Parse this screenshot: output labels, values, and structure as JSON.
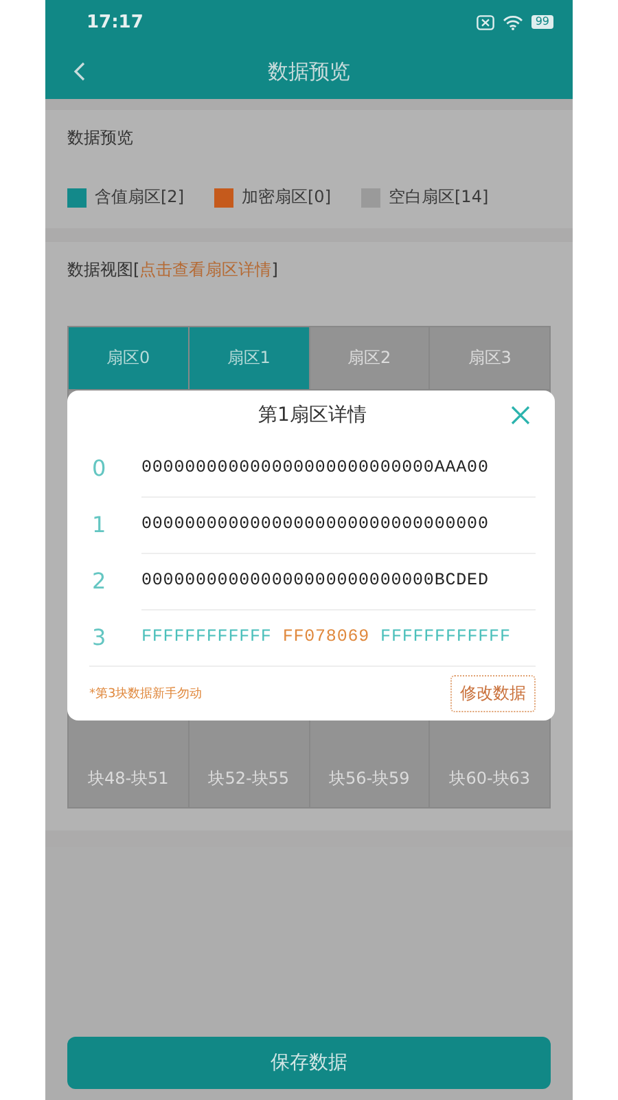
{
  "status_bar": {
    "time": "17:17",
    "battery": "99"
  },
  "header": {
    "title": "数据预览"
  },
  "preview": {
    "title": "数据预览",
    "legend": [
      {
        "label": "含值扇区[2]",
        "color": "#13898a"
      },
      {
        "label": "加密扇区[0]",
        "color": "#c55a1c"
      },
      {
        "label": "空白扇区[14]",
        "color": "#9a9a9a"
      }
    ]
  },
  "view": {
    "title_start": "数据视图[",
    "link": "点击查看扇区详情",
    "title_end": "]"
  },
  "sectors": [
    {
      "label": "扇区0",
      "has_value": true
    },
    {
      "label": "扇区1",
      "has_value": true
    },
    {
      "label": "扇区2",
      "has_value": false
    },
    {
      "label": "扇区3",
      "has_value": false
    }
  ],
  "block_ranges": [
    {
      "label": "块48-块51"
    },
    {
      "label": "块52-块55"
    },
    {
      "label": "块56-块59"
    },
    {
      "label": "块60-块63"
    }
  ],
  "dialog": {
    "title": "第1扇区详情",
    "rows": [
      {
        "index": "0",
        "segments": [
          {
            "text": "000000000000000000000000000AAA00",
            "kind": "plain"
          }
        ]
      },
      {
        "index": "1",
        "segments": [
          {
            "text": "00000000000000000000000000000000",
            "kind": "plain"
          }
        ]
      },
      {
        "index": "2",
        "segments": [
          {
            "text": "000000000000000000000000000BCDED",
            "kind": "plain"
          }
        ]
      },
      {
        "index": "3",
        "segments": [
          {
            "text": "FFFFFFFFFFFF",
            "kind": "key"
          },
          {
            "text": "FF078069",
            "kind": "access"
          },
          {
            "text": "FFFFFFFFFFFF",
            "kind": "key"
          }
        ]
      }
    ],
    "note": "*第3块数据新手勿动",
    "edit_button": "修改数据"
  },
  "save_button": "保存数据"
}
